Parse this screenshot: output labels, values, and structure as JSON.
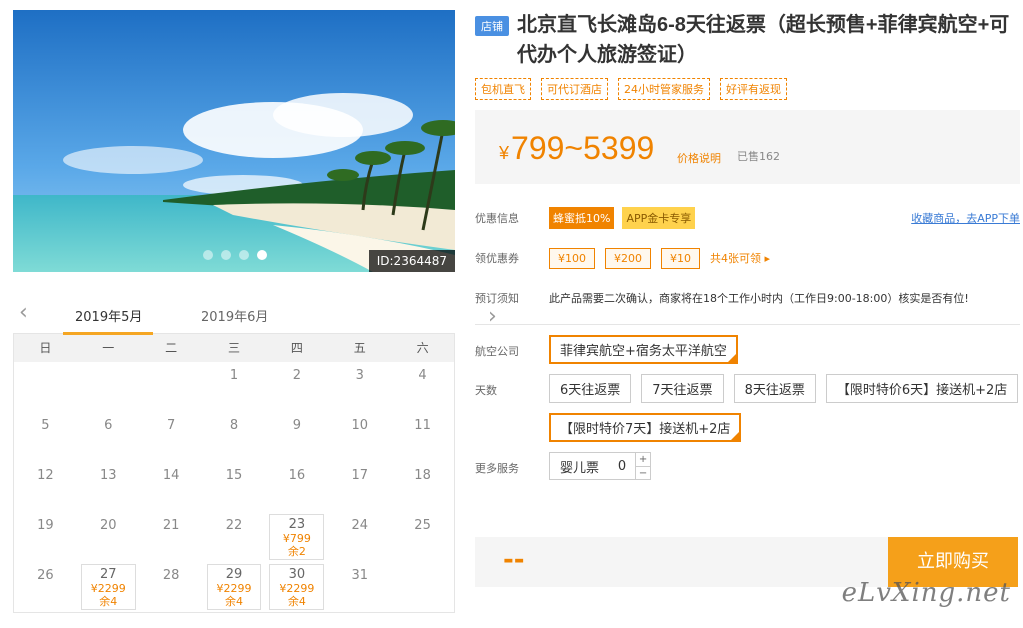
{
  "photo": {
    "id_label": "ID:2364487",
    "dots": 4,
    "active_dot": 4
  },
  "calendar": {
    "months": [
      "2019年5月",
      "2019年6月"
    ],
    "weekdays": [
      "日",
      "一",
      "二",
      "三",
      "四",
      "五",
      "六"
    ],
    "rows": [
      [
        {
          "d": ""
        },
        {
          "d": ""
        },
        {
          "d": ""
        },
        {
          "d": "1"
        },
        {
          "d": "2"
        },
        {
          "d": "3"
        },
        {
          "d": "4"
        }
      ],
      [
        {
          "d": "5"
        },
        {
          "d": "6"
        },
        {
          "d": "7"
        },
        {
          "d": "8"
        },
        {
          "d": "9"
        },
        {
          "d": "10"
        },
        {
          "d": "11"
        }
      ],
      [
        {
          "d": "12"
        },
        {
          "d": "13"
        },
        {
          "d": "14"
        },
        {
          "d": "15"
        },
        {
          "d": "16"
        },
        {
          "d": "17"
        },
        {
          "d": "18"
        }
      ],
      [
        {
          "d": "19"
        },
        {
          "d": "20"
        },
        {
          "d": "21"
        },
        {
          "d": "22"
        },
        {
          "d": "23",
          "price": "¥799",
          "left": "余2"
        },
        {
          "d": "24"
        },
        {
          "d": "25"
        }
      ],
      [
        {
          "d": "26"
        },
        {
          "d": "27",
          "price": "¥2299",
          "left": "余4"
        },
        {
          "d": "28"
        },
        {
          "d": "29",
          "price": "¥2299",
          "left": "余4"
        },
        {
          "d": "30",
          "price": "¥2299",
          "left": "余4"
        },
        {
          "d": "31"
        },
        {
          "d": ""
        }
      ]
    ]
  },
  "product": {
    "shop_tag": "店铺",
    "title": "北京直飞长滩岛6-8天往返票（超长预售+菲律宾航空+可代办个人旅游签证）",
    "tags": [
      "包机直飞",
      "可代订酒店",
      "24小时管家服务",
      "好评有返现"
    ],
    "price_yen": "¥",
    "price_range": "799~5399",
    "price_note": "价格说明",
    "sold": "已售162"
  },
  "promo": {
    "label": "优惠信息",
    "badge1": "蜂蜜抵10%",
    "badge2": "APP金卡专享",
    "fav_link": "收藏商品，去APP下单"
  },
  "coupons": {
    "label": "领优惠券",
    "items": [
      "¥100",
      "¥200",
      "¥10"
    ],
    "more": "共4张可领 ▸"
  },
  "notice": {
    "label": "预订须知",
    "text": "此产品需要二次确认，商家将在18个工作小时内（工作日9:00-18:00）核实是否有位!"
  },
  "options": {
    "airline_label": "航空公司",
    "airline": "菲律宾航空+宿务太平洋航空",
    "days_label": "天数",
    "days": [
      "6天往返票",
      "7天往返票",
      "8天往返票",
      "【限时特价6天】接送机+2店",
      "【限时特价7天】接送机+2店"
    ],
    "days_selected": 4,
    "extra_label": "更多服务",
    "infant_label": "婴儿票",
    "infant_qty": "0",
    "plus": "+",
    "minus": "−"
  },
  "buy": {
    "total": "--",
    "button": "立即购买"
  },
  "watermark": "eLvXing.net",
  "colors": {
    "accent": "#f08300",
    "button": "#f5a01a",
    "link": "#3a7bd5",
    "shop_tag": "#4a90e2"
  }
}
